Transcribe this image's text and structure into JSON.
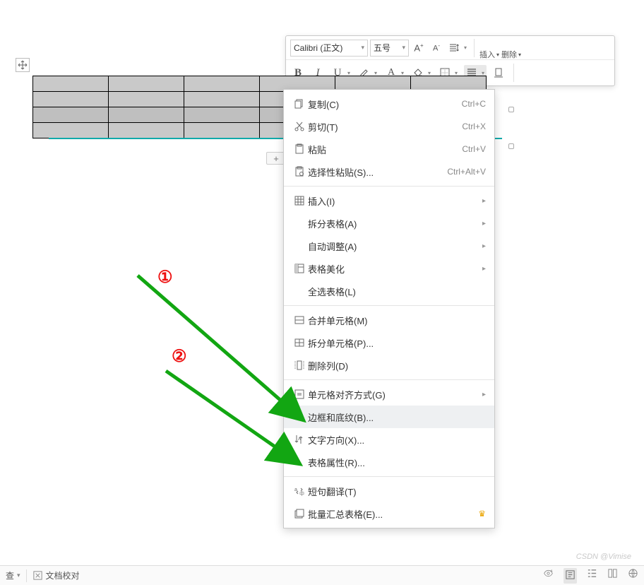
{
  "toolbar": {
    "font_name": "Calibri (正文)",
    "font_size": "五号",
    "insert_label": "插入",
    "delete_label": "删除"
  },
  "context_menu": {
    "copy": {
      "label": "复制(C)",
      "shortcut": "Ctrl+C"
    },
    "cut": {
      "label": "剪切(T)",
      "shortcut": "Ctrl+X"
    },
    "paste": {
      "label": "粘贴",
      "shortcut": "Ctrl+V"
    },
    "paste_special": {
      "label": "选择性粘贴(S)...",
      "shortcut": "Ctrl+Alt+V"
    },
    "insert": {
      "label": "插入(I)"
    },
    "split_table": {
      "label": "拆分表格(A)"
    },
    "auto_fit": {
      "label": "自动调整(A)"
    },
    "table_beautify": {
      "label": "表格美化"
    },
    "select_all_table": {
      "label": "全选表格(L)"
    },
    "merge_cells": {
      "label": "合并单元格(M)"
    },
    "split_cells": {
      "label": "拆分单元格(P)..."
    },
    "delete_column": {
      "label": "删除列(D)"
    },
    "cell_align": {
      "label": "单元格对齐方式(G)"
    },
    "borders_shading": {
      "label": "边框和底纹(B)..."
    },
    "text_direction": {
      "label": "文字方向(X)..."
    },
    "table_props": {
      "label": "表格属性(R)..."
    },
    "translate": {
      "label": "短句翻译(T)"
    },
    "batch_summary": {
      "label": "批量汇总表格(E)..."
    }
  },
  "annotations": {
    "one": "①",
    "two": "②"
  },
  "status": {
    "proofread": "文档校对",
    "check_label": "查"
  },
  "watermark": "CSDN @Vimise"
}
